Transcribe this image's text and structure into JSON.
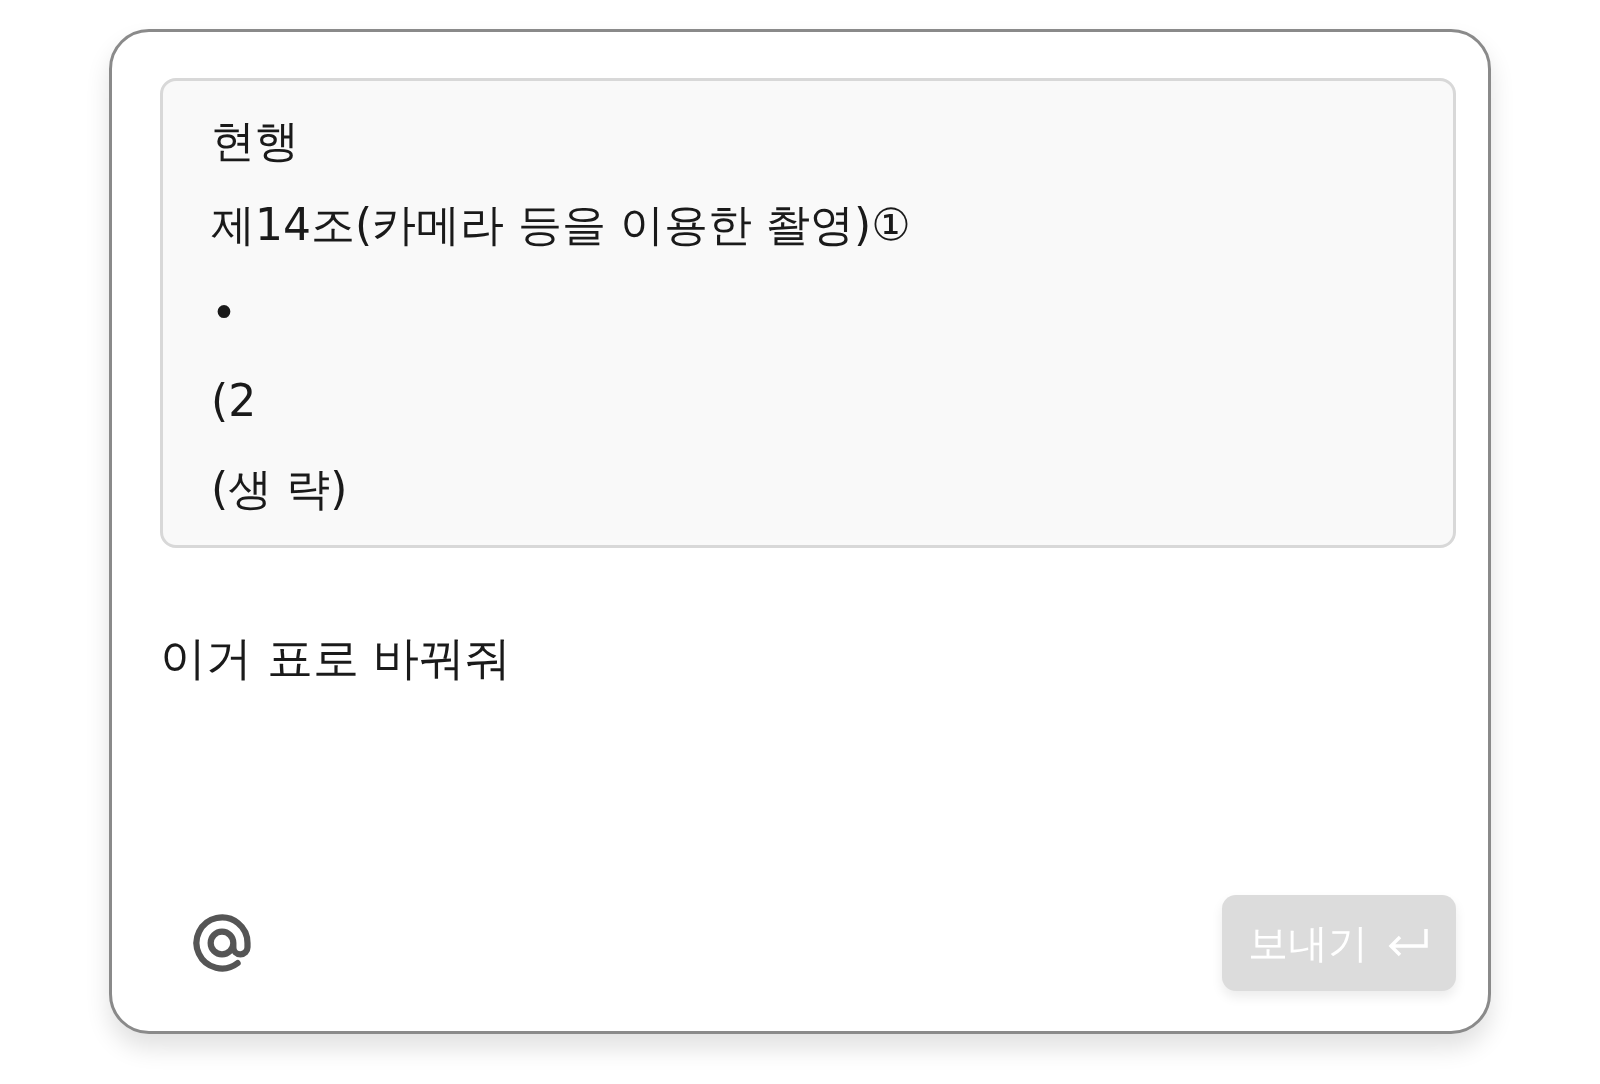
{
  "quote": {
    "lines": [
      "현행",
      "제14조(카메라 등을 이용한 촬영)①",
      "•",
      "(2",
      "(생 략)"
    ]
  },
  "message": {
    "value": "이거 표로 바꿔줘"
  },
  "send_button": {
    "label": "보내기",
    "disabled": true
  }
}
